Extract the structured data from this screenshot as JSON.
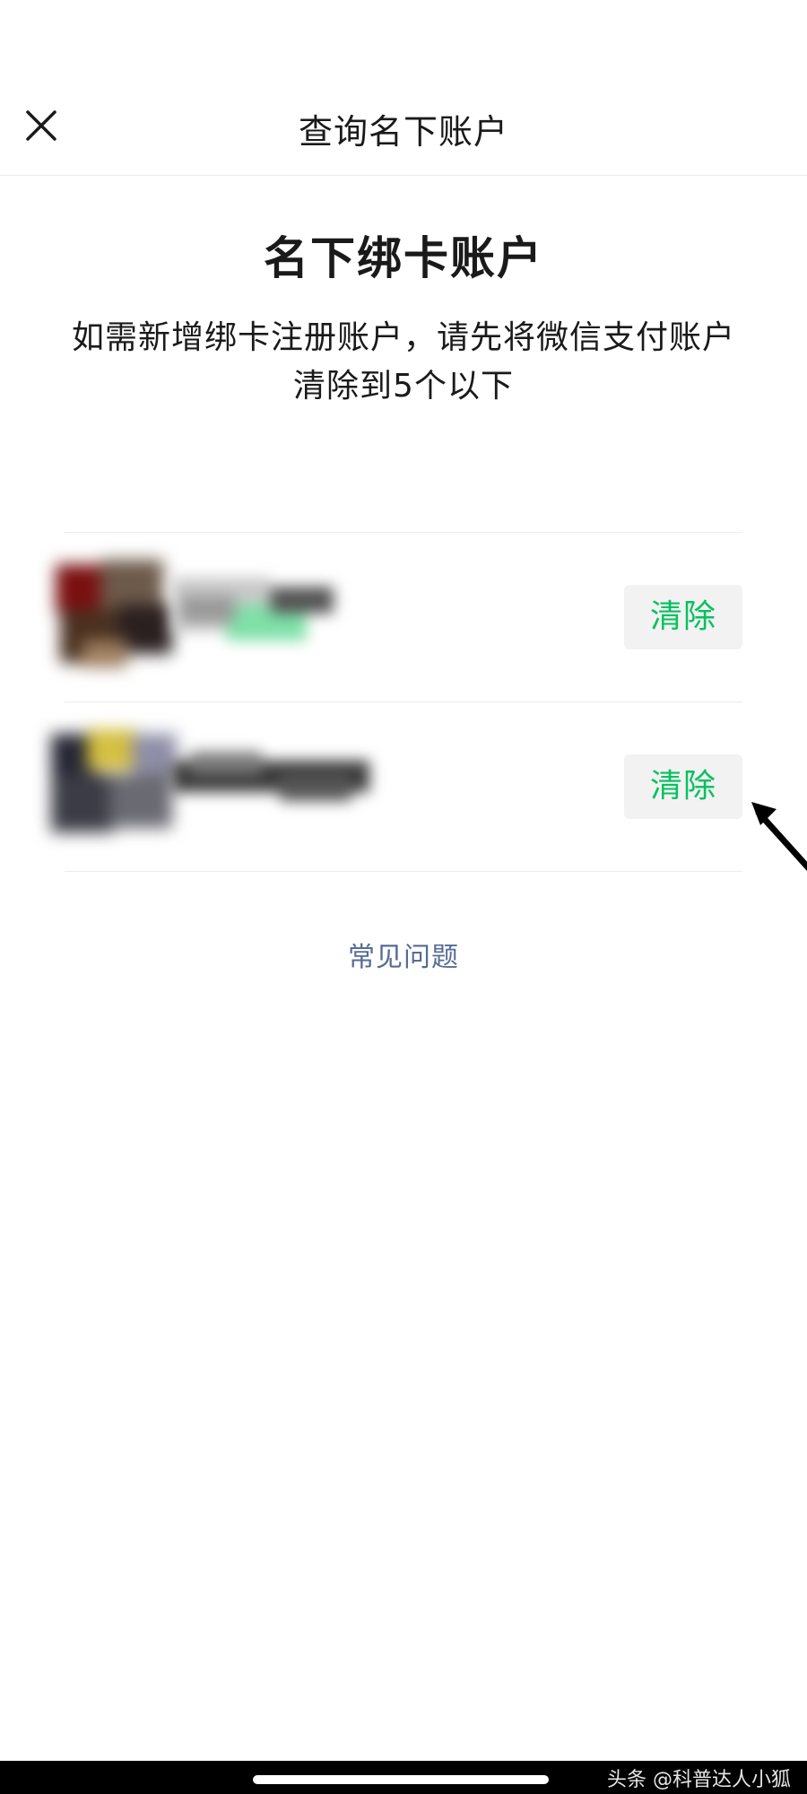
{
  "nav": {
    "title": "查询名下账户",
    "close_icon": "close-icon"
  },
  "main": {
    "headline": "名下绑卡账户",
    "description": "如需新增绑卡注册账户，请先将微信支付账户清除到5个以下"
  },
  "accounts": [
    {
      "avatar": "blurred-avatar",
      "name": "",
      "clear_label": "清除"
    },
    {
      "avatar": "blurred-avatar",
      "name": "",
      "clear_label": "清除"
    }
  ],
  "faq_label": "常见问题",
  "watermark": "头条 @科普达人小狐",
  "colors": {
    "accent_green": "#07c160",
    "link_blue": "#576b95",
    "button_bg": "#f2f2f2"
  }
}
